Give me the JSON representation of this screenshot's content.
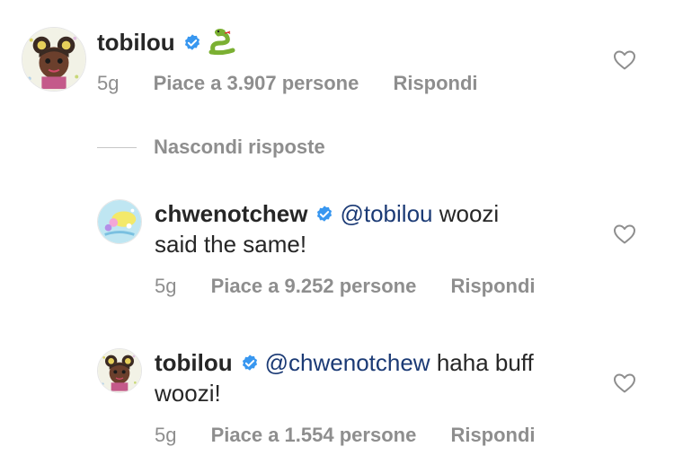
{
  "comments": [
    {
      "username": "tobilou",
      "verified": true,
      "mention": "",
      "text_line1": "",
      "text_line2": "",
      "emoji": "snake",
      "time": "5g",
      "likes": "Piace a 3.907 persone",
      "reply": "Rispondi",
      "avatar_icon": "illustrated-girl-avatar"
    },
    {
      "username": "chwenotchew",
      "verified": true,
      "mention": "@tobilou",
      "text_line1": "woozi",
      "text_line2": "said the same!",
      "time": "5g",
      "likes": "Piace a 9.252 persone",
      "reply": "Rispondi",
      "avatar_icon": "illustrated-flowers-avatar"
    },
    {
      "username": "tobilou",
      "verified": true,
      "mention": "@chwenotchew",
      "text_line1": "haha buff",
      "text_line2": "woozi!",
      "time": "5g",
      "likes": "Piace a 1.554 persone",
      "reply": "Rispondi",
      "avatar_icon": "illustrated-girl-avatar"
    }
  ],
  "hide_replies_label": "Nascondi risposte",
  "colors": {
    "text": "#262626",
    "meta": "#8e8e8e",
    "mention": "#1b3a75",
    "verified": "#3897f0",
    "heart_outline": "#8e8e8e"
  }
}
